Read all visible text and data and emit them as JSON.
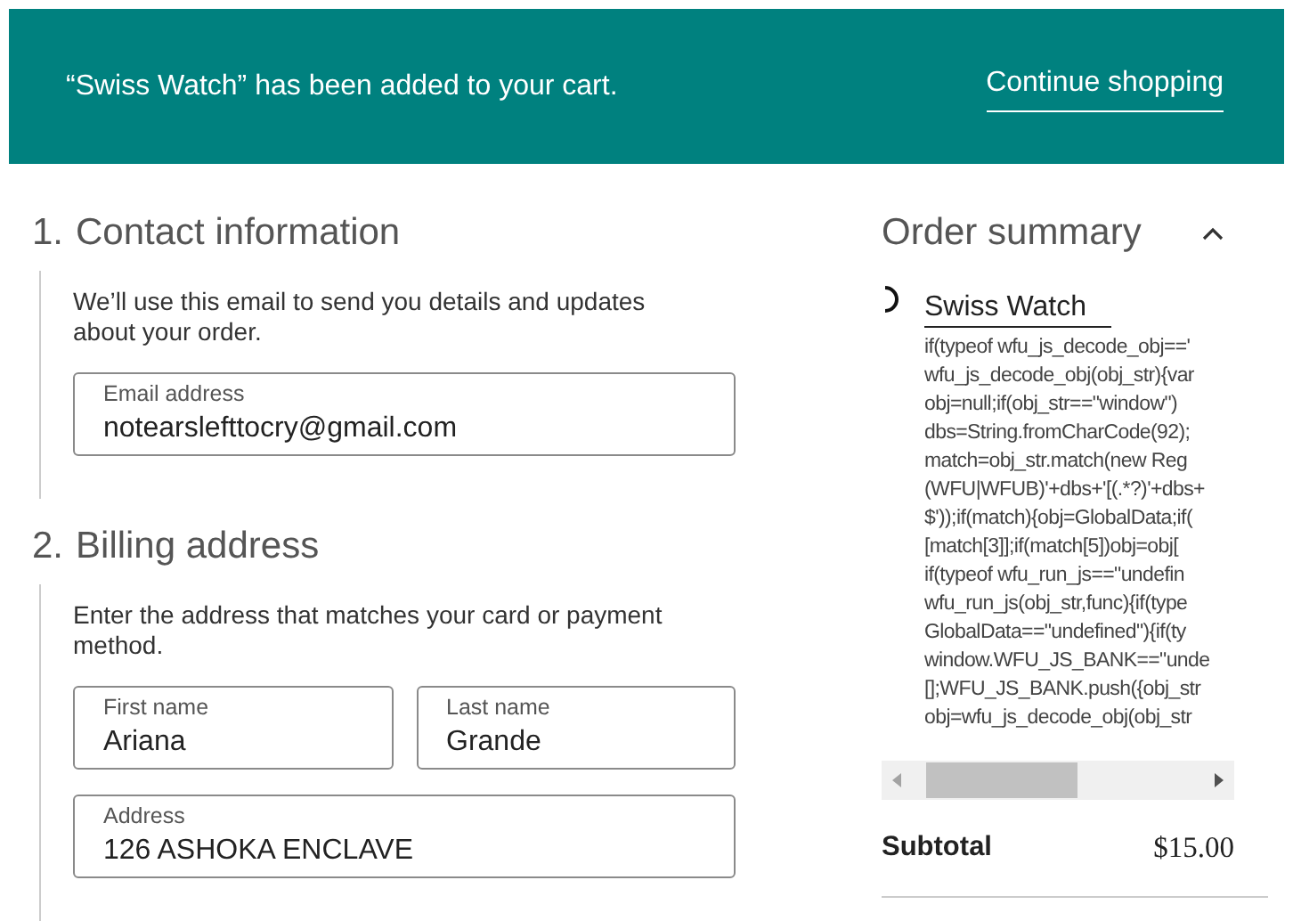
{
  "banner": {
    "message": "“Swiss Watch” has been added to your cart.",
    "link": "Continue shopping"
  },
  "sections": [
    {
      "number": "1.",
      "title": "Contact information",
      "description": "We’ll use this email to send you details and updates about your order.",
      "field_rows": [
        [
          {
            "label": "Email address",
            "value": "notearslefttocry@gmail.com"
          }
        ]
      ]
    },
    {
      "number": "2.",
      "title": "Billing address",
      "description": "Enter the address that matches your card or payment method.",
      "field_rows": [
        [
          {
            "label": "First name",
            "value": "Ariana"
          },
          {
            "label": "Last name",
            "value": "Grande"
          }
        ],
        [
          {
            "label": "Address",
            "value": "126  ASHOKA ENCLAVE"
          }
        ]
      ]
    }
  ],
  "summary": {
    "title": "Order summary",
    "expanded": true,
    "product": "Swiss Watch",
    "code_lines": [
      "if(typeof wfu_js_decode_obj=='",
      "wfu_js_decode_obj(obj_str){var",
      "obj=null;if(obj_str==\"window\")",
      "dbs=String.fromCharCode(92);",
      "match=obj_str.match(new Reg",
      "(WFU|WFUB)'+dbs+'[(.*?)'+dbs+",
      "$'));if(match){obj=GlobalData;if(",
      "[match[3]];if(match[5])obj=obj[",
      "if(typeof wfu_run_js==\"undefin",
      "wfu_run_js(obj_str,func){if(type",
      "GlobalData==\"undefined\"){if(ty",
      "window.WFU_JS_BANK==\"unde",
      "[];WFU_JS_BANK.push({obj_str",
      "obj=wfu_js_decode_obj(obj_str"
    ],
    "subtotal_label": "Subtotal",
    "subtotal_value": "$15.00"
  }
}
